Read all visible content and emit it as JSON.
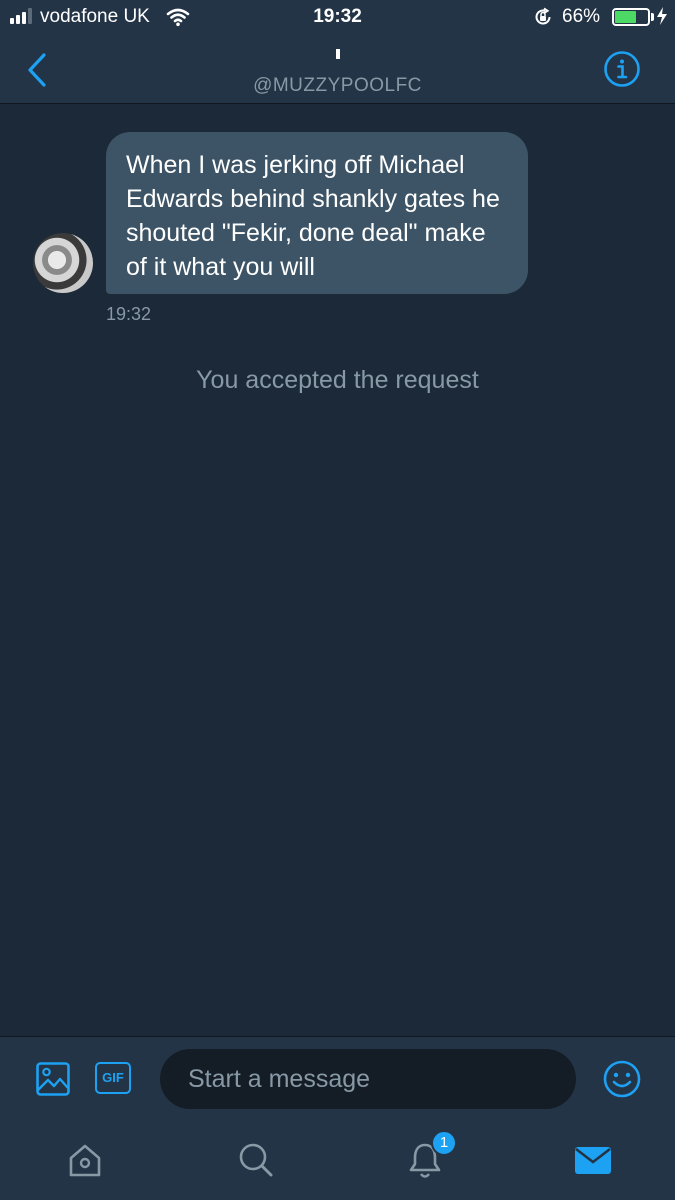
{
  "status_bar": {
    "carrier": "vodafone UK",
    "time": "19:32",
    "battery_percent": "66%",
    "battery_level": 0.66,
    "icons": [
      "signal-icon",
      "wifi-icon",
      "rotation-lock-icon",
      "battery-icon",
      "charging-bolt-icon"
    ]
  },
  "header": {
    "handle": "@MUZZYPOOLFC",
    "back_icon": "chevron-left-icon",
    "info_icon": "info-icon"
  },
  "conversation": {
    "messages": [
      {
        "text": "When I was jerking off Michael Edwards behind shankly gates he shouted \"Fekir, done deal\" make of it what you will",
        "time": "19:32",
        "direction": "incoming"
      }
    ],
    "system_message": "You accepted the request"
  },
  "composer": {
    "placeholder": "Start a message",
    "value": "",
    "gif_label": "GIF",
    "icons": [
      "image-icon",
      "gif-icon",
      "emoji-icon"
    ]
  },
  "tabbar": {
    "tabs": [
      "home",
      "search",
      "notifications",
      "messages"
    ],
    "active_tab": "messages",
    "notification_count": "1"
  },
  "colors": {
    "background": "#1c2938",
    "header": "#243447",
    "bubble": "#3d5466",
    "accent": "#1da1f2",
    "muted_text": "#8899a6",
    "input": "#141d26",
    "battery": "#4cd964"
  }
}
